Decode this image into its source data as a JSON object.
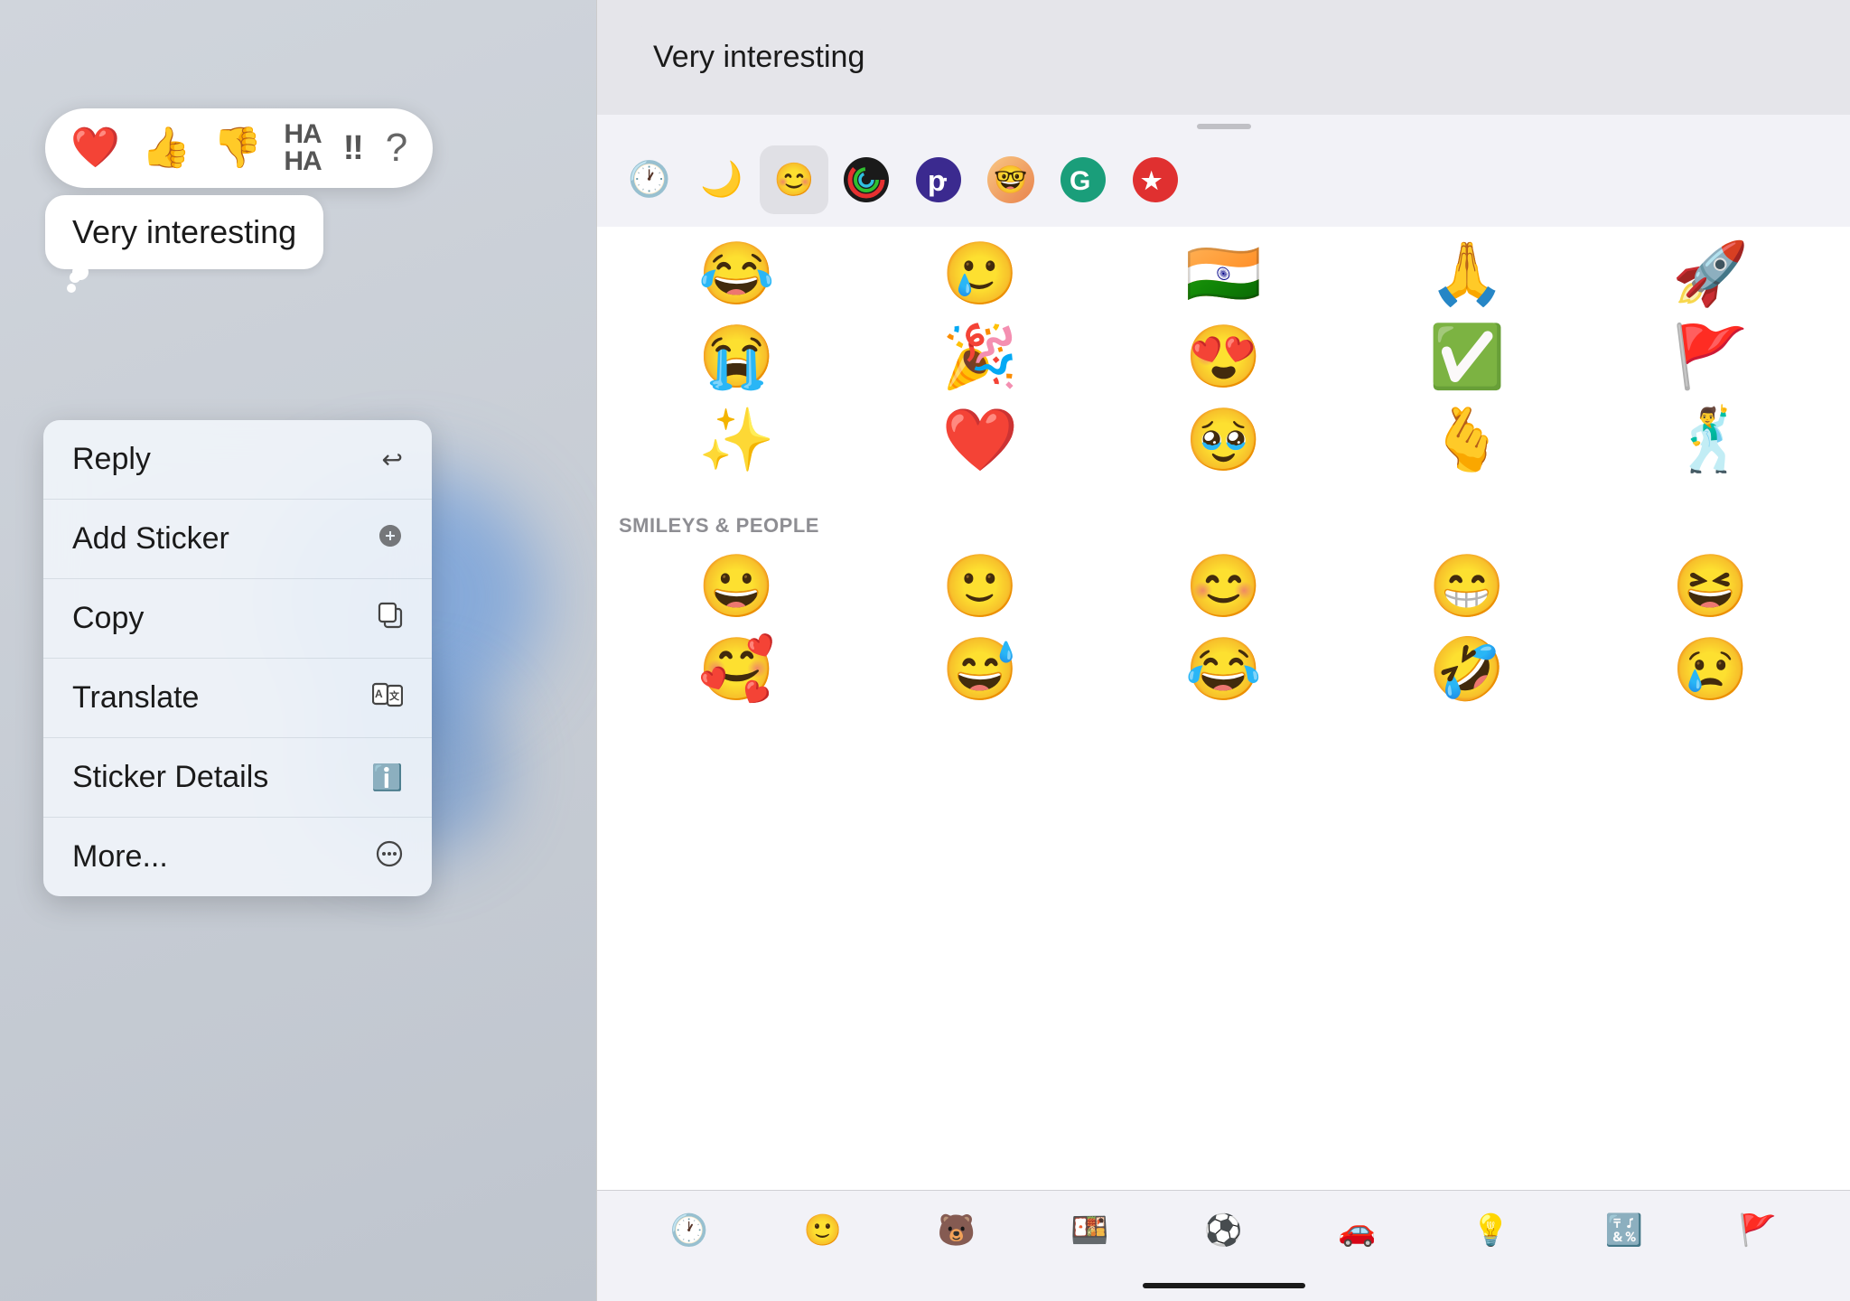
{
  "left": {
    "message_text": "Very interesting",
    "tapback_icons": [
      "❤️",
      "👍",
      "👎",
      "HAHA",
      "!!",
      "?"
    ],
    "menu_items": [
      {
        "label": "Reply",
        "icon": "↩"
      },
      {
        "label": "Add Sticker",
        "icon": "🏷+"
      },
      {
        "label": "Copy",
        "icon": "📋"
      },
      {
        "label": "Translate",
        "icon": "🅰🅱"
      },
      {
        "label": "Sticker Details",
        "icon": "ℹ"
      },
      {
        "label": "More...",
        "icon": "⋯"
      }
    ]
  },
  "right": {
    "header_message": "Very interesting",
    "section_label": "SMILEYS & PEOPLE",
    "recent_emojis": [
      "😂",
      "🥲",
      "🇮🇳",
      "🙏",
      "🚀",
      "😭",
      "🎉",
      "😍",
      "✅",
      "🚩",
      "✨",
      "❤️",
      "🥹",
      "🫰",
      "🕺"
    ],
    "smileys": [
      "😀",
      "🙂",
      "😊",
      "😁",
      "😆",
      "🥰",
      "😅",
      "😂",
      "🤣",
      "😢"
    ]
  }
}
